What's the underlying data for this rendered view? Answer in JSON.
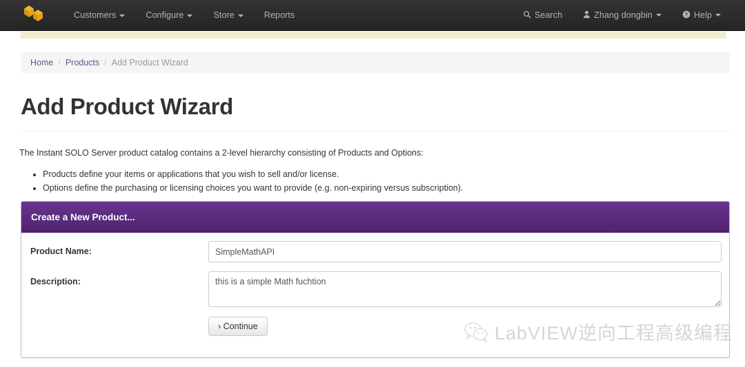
{
  "navbar": {
    "brand_icon": "cube-logo-icon",
    "left_items": [
      {
        "label": "Customers",
        "has_caret": true
      },
      {
        "label": "Configure",
        "has_caret": true
      },
      {
        "label": "Store",
        "has_caret": true
      },
      {
        "label": "Reports",
        "has_caret": false
      }
    ],
    "right_items": [
      {
        "label": "Search",
        "icon": "search-icon",
        "has_caret": false
      },
      {
        "label": "Zhang dongbin",
        "icon": "user-icon",
        "has_caret": true
      },
      {
        "label": "Help",
        "icon": "question-circle-icon",
        "has_caret": true
      }
    ],
    "background_color": "#2b2b2b"
  },
  "alert": {
    "background_color": "#f2eccf"
  },
  "breadcrumb": {
    "items": [
      {
        "label": "Home",
        "active": false
      },
      {
        "label": "Products",
        "active": false
      },
      {
        "label": "Add Product Wizard",
        "active": true
      }
    ],
    "separator": "/",
    "link_color": "#6b4f8a"
  },
  "page": {
    "title": "Add Product Wizard",
    "intro": "The Instant SOLO Server product catalog contains a 2-level hierarchy consisting of Products and Options:",
    "bullets": [
      "Products define your items or applications that you wish to sell and/or license.",
      "Options define the purchasing or licensing choices you want to provide (e.g. non-expiring versus subscription)."
    ]
  },
  "panel": {
    "title": "Create a New Product...",
    "header_color": "#5c2d82",
    "form": {
      "product_name": {
        "label": "Product Name:",
        "value": "SimpleMathAPI",
        "placeholder": ""
      },
      "description": {
        "label": "Description:",
        "value": "this is a simple Math fuchtion",
        "placeholder": ""
      },
      "continue_button": "› Continue"
    }
  },
  "watermark": {
    "icon": "wechat-icon",
    "text": "LabVIEW逆向工程高级编程",
    "color": "#d5d5d5"
  }
}
